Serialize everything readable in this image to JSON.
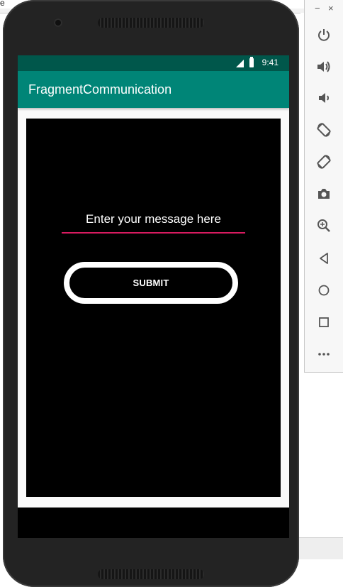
{
  "ide": {
    "top_left_text": "e"
  },
  "emulator_toolbar": {
    "minimize_label": "−",
    "close_label": "×",
    "buttons": [
      {
        "name": "power-icon"
      },
      {
        "name": "volume-up-icon"
      },
      {
        "name": "volume-down-icon"
      },
      {
        "name": "rotate-left-icon"
      },
      {
        "name": "rotate-right-icon"
      },
      {
        "name": "camera-icon"
      },
      {
        "name": "zoom-icon"
      },
      {
        "name": "back-icon"
      },
      {
        "name": "home-icon"
      },
      {
        "name": "overview-icon"
      },
      {
        "name": "more-icon"
      }
    ]
  },
  "status_bar": {
    "time": "9:41",
    "color": "#00574b"
  },
  "app_bar": {
    "title": "FragmentCommunication",
    "color": "#008577"
  },
  "fragment": {
    "message_input": {
      "placeholder": "Enter your message here",
      "value": "",
      "underline_color": "#d81b60"
    },
    "submit_label": "SUBMIT"
  }
}
